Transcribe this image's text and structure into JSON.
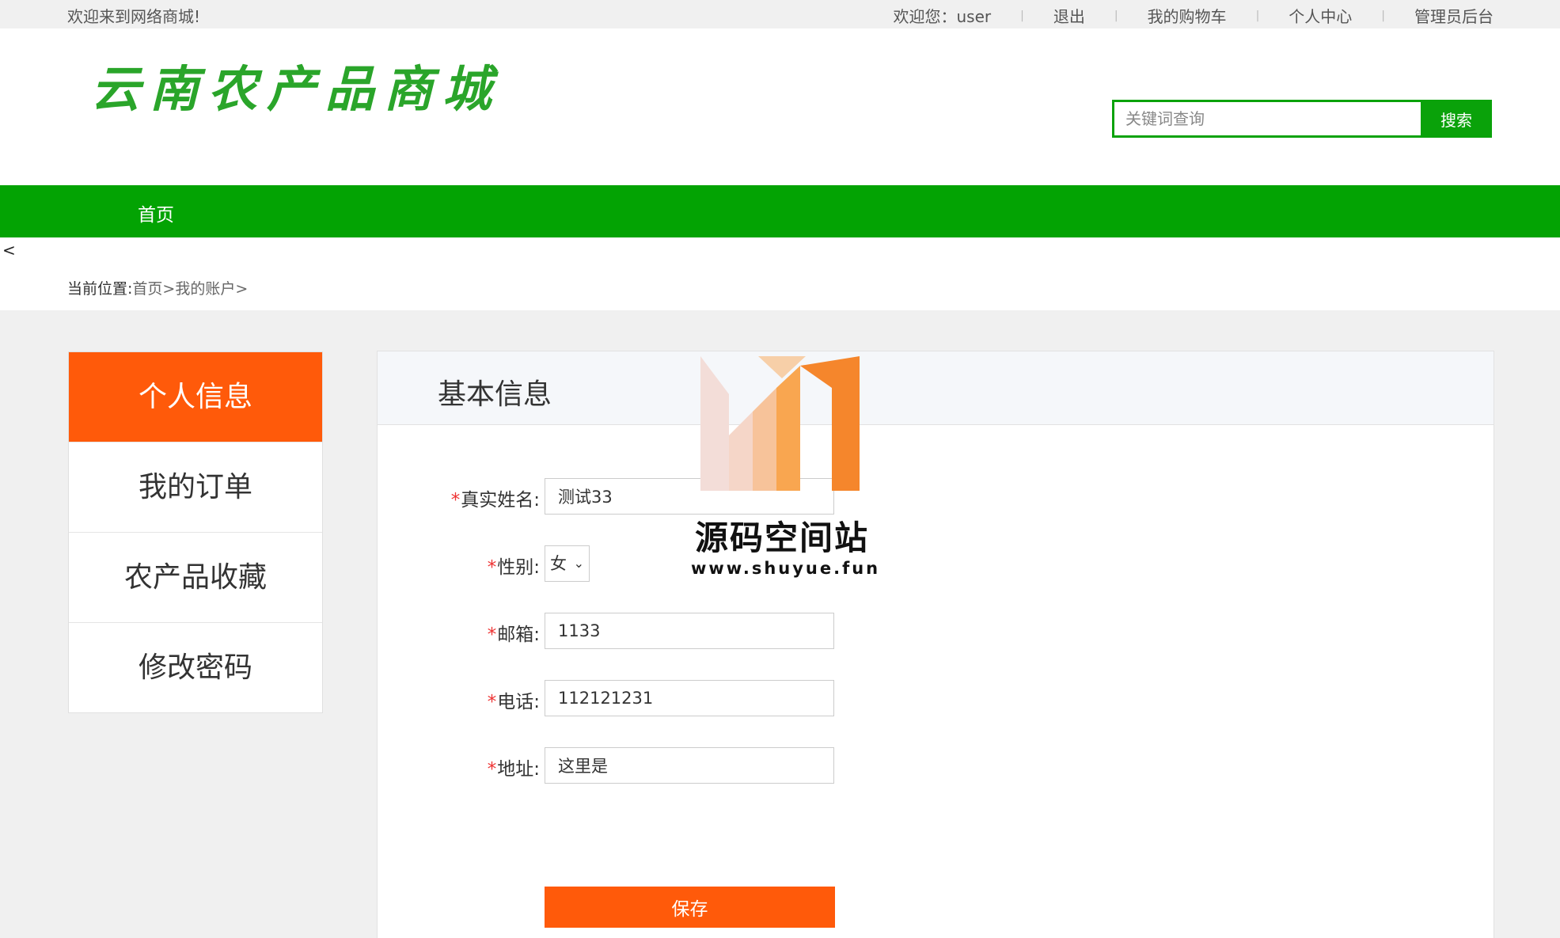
{
  "topbar": {
    "welcome": "欢迎来到网络商城!",
    "greeting": "欢迎您：user",
    "logout": "退出",
    "cart": "我的购物车",
    "profile": "个人中心",
    "admin": "管理员后台",
    "separator": "|"
  },
  "header": {
    "logo": "云南农产品商城",
    "search_placeholder": "关键词查询",
    "search_button": "搜索"
  },
  "nav": {
    "home": "首页"
  },
  "stray_char": "<",
  "breadcrumb": {
    "prefix": "当前位置:",
    "home": "首页",
    "arrow1": ">",
    "account": "我的账户",
    "arrow2": ">"
  },
  "sidebar": {
    "items": [
      "个人信息",
      "我的订单",
      "农产品收藏",
      "修改密码"
    ],
    "active_index": 0
  },
  "panel": {
    "title": "基本信息",
    "required_mark": "*",
    "fields": {
      "name_label": "真实姓名:",
      "name_value": "测试33",
      "gender_label": "性别:",
      "gender_value": "女",
      "email_label": "邮箱:",
      "email_value": "1133",
      "phone_label": "电话:",
      "phone_value": "112121231",
      "address_label": "地址:",
      "address_value": "这里是"
    },
    "save_button": "保存"
  },
  "watermark": {
    "text": "源码空间站",
    "url": "www.shuyue.fun"
  },
  "colors": {
    "brand_green": "#03a303",
    "accent_orange": "#ff5a0a",
    "logo_green": "#2aa52a"
  }
}
